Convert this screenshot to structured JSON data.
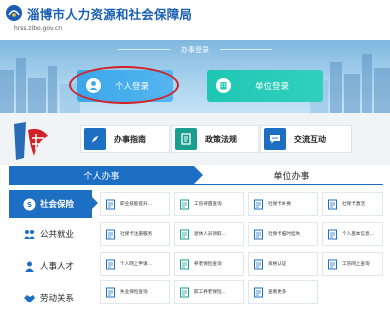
{
  "header": {
    "site_title": "淄博市人力资源和社会保障局",
    "site_url": "hrss.zibo.gov.cn"
  },
  "banner": {
    "title": "办事登录",
    "personal_login": "个人登录",
    "unit_login": "单位登录"
  },
  "quick_links": {
    "guide": "办事指南",
    "policy": "政策法规",
    "communication": "交流互动"
  },
  "tabs": {
    "personal": "个人办事",
    "unit": "单位办事"
  },
  "categories": [
    {
      "label": "社会保险",
      "active": true
    },
    {
      "label": "公共就业",
      "active": false
    },
    {
      "label": "人事人才",
      "active": false
    },
    {
      "label": "劳动关系",
      "active": false
    }
  ],
  "services": [
    [
      "职业技能提升…",
      "工伤待遇查询",
      "社保卡补换",
      "社保卡激活"
    ],
    [
      "社保卡注册服务",
      "退休人员领取…",
      "社保卡临时挂失",
      "个人基本信息…"
    ],
    [
      "个人网上申请…",
      "养老保险查询",
      "资格认证",
      "工伤网上查询"
    ],
    [
      "失业保险查询",
      "职工养老保险…",
      "查看更多",
      ""
    ]
  ],
  "colors": {
    "brand_blue": "#1d6fc4",
    "title_blue": "#1a5fb4",
    "personal_login": "#3aa7ea",
    "unit_login": "#1fc6b4",
    "highlight": "#d3232a"
  }
}
